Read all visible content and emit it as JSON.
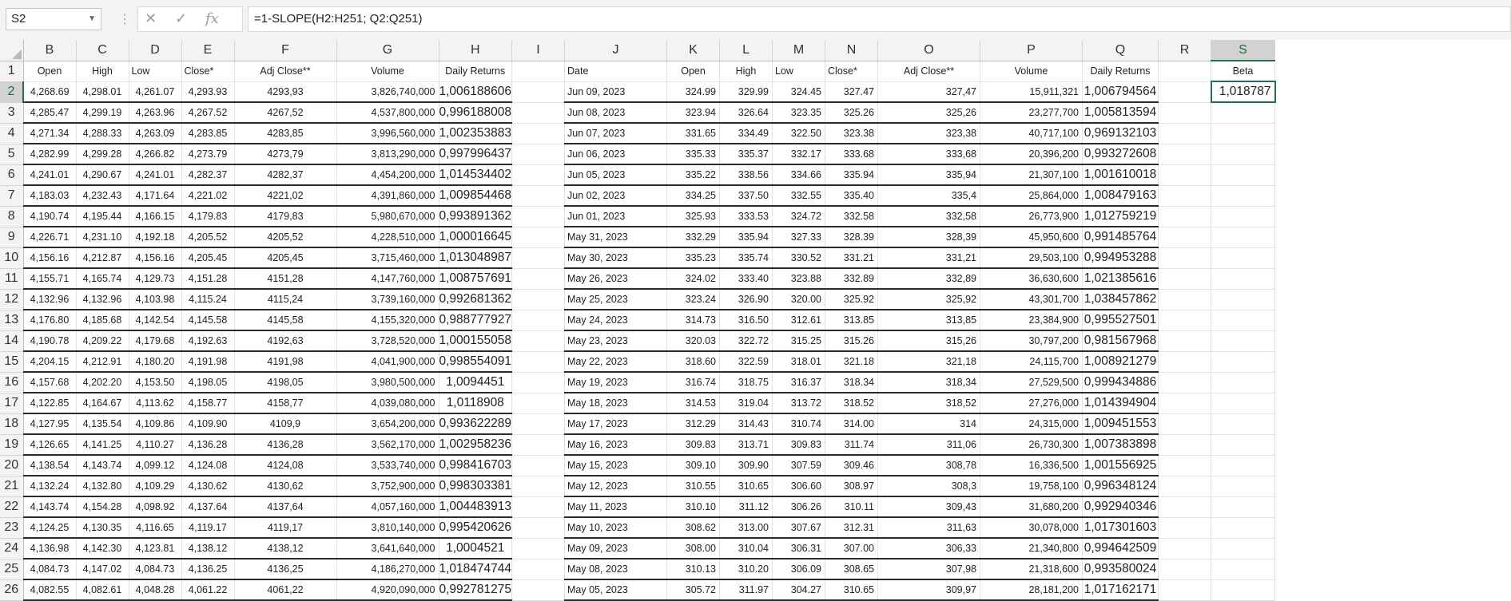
{
  "formula_bar": {
    "name_box": "S2",
    "formula": "=1-SLOPE(H2:H251; Q2:Q251)"
  },
  "columns": [
    "B",
    "C",
    "D",
    "E",
    "F",
    "G",
    "H",
    "I",
    "J",
    "K",
    "L",
    "M",
    "N",
    "O",
    "P",
    "Q",
    "R",
    "S"
  ],
  "selected_column": "S",
  "header_row": {
    "row_num": "1",
    "left": [
      "Open",
      "High",
      "Low",
      "Close*",
      "Adj Close**",
      "Volume",
      "Daily Returns",
      ""
    ],
    "right": [
      "Date",
      "Open",
      "High",
      "Low",
      "Close*",
      "Adj Close**",
      "Volume",
      "Daily Returns",
      ""
    ],
    "beta_label": "Beta"
  },
  "beta_value": "1,018787",
  "rows": [
    {
      "n": "2",
      "left": [
        "4,268.69",
        "4,298.01",
        "4,261.07",
        "4,293.93",
        "4293,93",
        "3,826,740,000",
        "1,006188606",
        ""
      ],
      "right": [
        "Jun 09, 2023",
        "324.99",
        "329.99",
        "324.45",
        "327.47",
        "327,47",
        "15,911,321",
        "1,006794564",
        ""
      ]
    },
    {
      "n": "3",
      "left": [
        "4,285.47",
        "4,299.19",
        "4,263.96",
        "4,267.52",
        "4267,52",
        "4,537,800,000",
        "0,996188008",
        ""
      ],
      "right": [
        "Jun 08, 2023",
        "323.94",
        "326.64",
        "323.35",
        "325.26",
        "325,26",
        "23,277,700",
        "1,005813594",
        ""
      ]
    },
    {
      "n": "4",
      "left": [
        "4,271.34",
        "4,288.33",
        "4,263.09",
        "4,283.85",
        "4283,85",
        "3,996,560,000",
        "1,002353883",
        ""
      ],
      "right": [
        "Jun 07, 2023",
        "331.65",
        "334.49",
        "322.50",
        "323.38",
        "323,38",
        "40,717,100",
        "0,969132103",
        ""
      ]
    },
    {
      "n": "5",
      "left": [
        "4,282.99",
        "4,299.28",
        "4,266.82",
        "4,273.79",
        "4273,79",
        "3,813,290,000",
        "0,997996437",
        ""
      ],
      "right": [
        "Jun 06, 2023",
        "335.33",
        "335.37",
        "332.17",
        "333.68",
        "333,68",
        "20,396,200",
        "0,993272608",
        ""
      ]
    },
    {
      "n": "6",
      "left": [
        "4,241.01",
        "4,290.67",
        "4,241.01",
        "4,282.37",
        "4282,37",
        "4,454,200,000",
        "1,014534402",
        ""
      ],
      "right": [
        "Jun 05, 2023",
        "335.22",
        "338.56",
        "334.66",
        "335.94",
        "335,94",
        "21,307,100",
        "1,001610018",
        ""
      ]
    },
    {
      "n": "7",
      "left": [
        "4,183.03",
        "4,232.43",
        "4,171.64",
        "4,221.02",
        "4221,02",
        "4,391,860,000",
        "1,009854468",
        ""
      ],
      "right": [
        "Jun 02, 2023",
        "334.25",
        "337.50",
        "332.55",
        "335.40",
        "335,4",
        "25,864,000",
        "1,008479163",
        ""
      ]
    },
    {
      "n": "8",
      "left": [
        "4,190.74",
        "4,195.44",
        "4,166.15",
        "4,179.83",
        "4179,83",
        "5,980,670,000",
        "0,993891362",
        ""
      ],
      "right": [
        "Jun 01, 2023",
        "325.93",
        "333.53",
        "324.72",
        "332.58",
        "332,58",
        "26,773,900",
        "1,012759219",
        ""
      ]
    },
    {
      "n": "9",
      "left": [
        "4,226.71",
        "4,231.10",
        "4,192.18",
        "4,205.52",
        "4205,52",
        "4,228,510,000",
        "1,000016645",
        ""
      ],
      "right": [
        "May 31, 2023",
        "332.29",
        "335.94",
        "327.33",
        "328.39",
        "328,39",
        "45,950,600",
        "0,991485764",
        ""
      ]
    },
    {
      "n": "10",
      "left": [
        "4,156.16",
        "4,212.87",
        "4,156.16",
        "4,205.45",
        "4205,45",
        "3,715,460,000",
        "1,013048987",
        ""
      ],
      "right": [
        "May 30, 2023",
        "335.23",
        "335.74",
        "330.52",
        "331.21",
        "331,21",
        "29,503,100",
        "0,994953288",
        ""
      ]
    },
    {
      "n": "11",
      "left": [
        "4,155.71",
        "4,165.74",
        "4,129.73",
        "4,151.28",
        "4151,28",
        "4,147,760,000",
        "1,008757691",
        ""
      ],
      "right": [
        "May 26, 2023",
        "324.02",
        "333.40",
        "323.88",
        "332.89",
        "332,89",
        "36,630,600",
        "1,021385616",
        ""
      ]
    },
    {
      "n": "12",
      "left": [
        "4,132.96",
        "4,132.96",
        "4,103.98",
        "4,115.24",
        "4115,24",
        "3,739,160,000",
        "0,992681362",
        ""
      ],
      "right": [
        "May 25, 2023",
        "323.24",
        "326.90",
        "320.00",
        "325.92",
        "325,92",
        "43,301,700",
        "1,038457862",
        ""
      ]
    },
    {
      "n": "13",
      "left": [
        "4,176.80",
        "4,185.68",
        "4,142.54",
        "4,145.58",
        "4145,58",
        "4,155,320,000",
        "0,988777927",
        ""
      ],
      "right": [
        "May 24, 2023",
        "314.73",
        "316.50",
        "312.61",
        "313.85",
        "313,85",
        "23,384,900",
        "0,995527501",
        ""
      ]
    },
    {
      "n": "14",
      "left": [
        "4,190.78",
        "4,209.22",
        "4,179.68",
        "4,192.63",
        "4192,63",
        "3,728,520,000",
        "1,000155058",
        ""
      ],
      "right": [
        "May 23, 2023",
        "320.03",
        "322.72",
        "315.25",
        "315.26",
        "315,26",
        "30,797,200",
        "0,981567968",
        ""
      ]
    },
    {
      "n": "15",
      "left": [
        "4,204.15",
        "4,212.91",
        "4,180.20",
        "4,191.98",
        "4191,98",
        "4,041,900,000",
        "0,998554091",
        ""
      ],
      "right": [
        "May 22, 2023",
        "318.60",
        "322.59",
        "318.01",
        "321.18",
        "321,18",
        "24,115,700",
        "1,008921279",
        ""
      ]
    },
    {
      "n": "16",
      "left": [
        "4,157.68",
        "4,202.20",
        "4,153.50",
        "4,198.05",
        "4198,05",
        "3,980,500,000",
        "1,0094451",
        ""
      ],
      "right": [
        "May 19, 2023",
        "316.74",
        "318.75",
        "316.37",
        "318.34",
        "318,34",
        "27,529,500",
        "0,999434886",
        ""
      ]
    },
    {
      "n": "17",
      "left": [
        "4,122.85",
        "4,164.67",
        "4,113.62",
        "4,158.77",
        "4158,77",
        "4,039,080,000",
        "1,0118908",
        ""
      ],
      "right": [
        "May 18, 2023",
        "314.53",
        "319.04",
        "313.72",
        "318.52",
        "318,52",
        "27,276,000",
        "1,014394904",
        ""
      ]
    },
    {
      "n": "18",
      "left": [
        "4,127.95",
        "4,135.54",
        "4,109.86",
        "4,109.90",
        "4109,9",
        "3,654,200,000",
        "0,993622289",
        ""
      ],
      "right": [
        "May 17, 2023",
        "312.29",
        "314.43",
        "310.74",
        "314.00",
        "314",
        "24,315,000",
        "1,009451553",
        ""
      ]
    },
    {
      "n": "19",
      "left": [
        "4,126.65",
        "4,141.25",
        "4,110.27",
        "4,136.28",
        "4136,28",
        "3,562,170,000",
        "1,002958236",
        ""
      ],
      "right": [
        "May 16, 2023",
        "309.83",
        "313.71",
        "309.83",
        "311.74",
        "311,06",
        "26,730,300",
        "1,007383898",
        ""
      ]
    },
    {
      "n": "20",
      "left": [
        "4,138.54",
        "4,143.74",
        "4,099.12",
        "4,124.08",
        "4124,08",
        "3,533,740,000",
        "0,998416703",
        ""
      ],
      "right": [
        "May 15, 2023",
        "309.10",
        "309.90",
        "307.59",
        "309.46",
        "308,78",
        "16,336,500",
        "1,001556925",
        ""
      ]
    },
    {
      "n": "21",
      "left": [
        "4,132.24",
        "4,132.80",
        "4,109.29",
        "4,130.62",
        "4130,62",
        "3,752,900,000",
        "0,998303381",
        ""
      ],
      "right": [
        "May 12, 2023",
        "310.55",
        "310.65",
        "306.60",
        "308.97",
        "308,3",
        "19,758,100",
        "0,996348124",
        ""
      ]
    },
    {
      "n": "22",
      "left": [
        "4,143.74",
        "4,154.28",
        "4,098.92",
        "4,137.64",
        "4137,64",
        "4,057,160,000",
        "1,004483913",
        ""
      ],
      "right": [
        "May 11, 2023",
        "310.10",
        "311.12",
        "306.26",
        "310.11",
        "309,43",
        "31,680,200",
        "0,992940346",
        ""
      ]
    },
    {
      "n": "23",
      "left": [
        "4,124.25",
        "4,130.35",
        "4,116.65",
        "4,119.17",
        "4119,17",
        "3,810,140,000",
        "0,995420626",
        ""
      ],
      "right": [
        "May 10, 2023",
        "308.62",
        "313.00",
        "307.67",
        "312.31",
        "311,63",
        "30,078,000",
        "1,017301603",
        ""
      ]
    },
    {
      "n": "24",
      "left": [
        "4,136.98",
        "4,142.30",
        "4,123.81",
        "4,138.12",
        "4138,12",
        "3,641,640,000",
        "1,0004521",
        ""
      ],
      "right": [
        "May 09, 2023",
        "308.00",
        "310.04",
        "306.31",
        "307.00",
        "306,33",
        "21,340,800",
        "0,994642509",
        ""
      ]
    },
    {
      "n": "25",
      "left": [
        "4,084.73",
        "4,147.02",
        "4,084.73",
        "4,136.25",
        "4136,25",
        "4,186,270,000",
        "1,018474744",
        ""
      ],
      "right": [
        "May 08, 2023",
        "310.13",
        "310.20",
        "306.09",
        "308.65",
        "307,98",
        "21,318,600",
        "0,993580024",
        ""
      ]
    },
    {
      "n": "26",
      "left": [
        "4,082.55",
        "4,082.61",
        "4,048.28",
        "4,061.22",
        "4061,22",
        "4,920,090,000",
        "0,992781275",
        ""
      ],
      "right": [
        "May 05, 2023",
        "305.72",
        "311.97",
        "304.27",
        "310.65",
        "309,97",
        "28,181,200",
        "1,017162171",
        ""
      ]
    }
  ]
}
